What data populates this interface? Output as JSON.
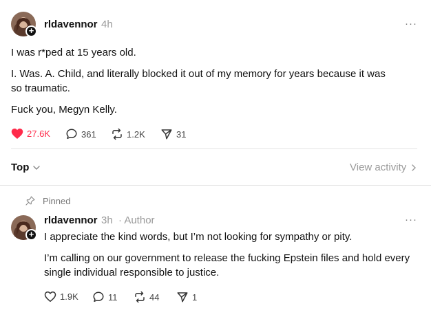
{
  "post": {
    "username": "rldavennor",
    "time": "4h",
    "more": "···",
    "paragraphs": [
      "I was r*ped at 15 years old.",
      "I. Was. A. Child, and literally blocked it out of my memory for years because it was so traumatic.",
      "Fuck you, Megyn Kelly."
    ],
    "actions": {
      "likes": "27.6K",
      "replies": "361",
      "reposts": "1.2K",
      "shares": "31"
    },
    "liked": true
  },
  "sort": {
    "label": "Top",
    "view_activity": "View activity"
  },
  "reply": {
    "pinned_label": "Pinned",
    "username": "rldavennor",
    "time": "3h",
    "role": "· Author",
    "more": "···",
    "paragraphs": [
      "I appreciate the kind words, but I’m not looking for sympathy or pity.",
      "I’m calling on our government to release the fucking Epstein files and hold every single individual responsible to justice."
    ],
    "actions": {
      "likes": "1.9K",
      "replies": "11",
      "reposts": "44",
      "shares": "1"
    }
  },
  "colors": {
    "like_active": "#ff2a4a",
    "muted": "#9a9a9a",
    "divider": "#e2e2e2"
  }
}
